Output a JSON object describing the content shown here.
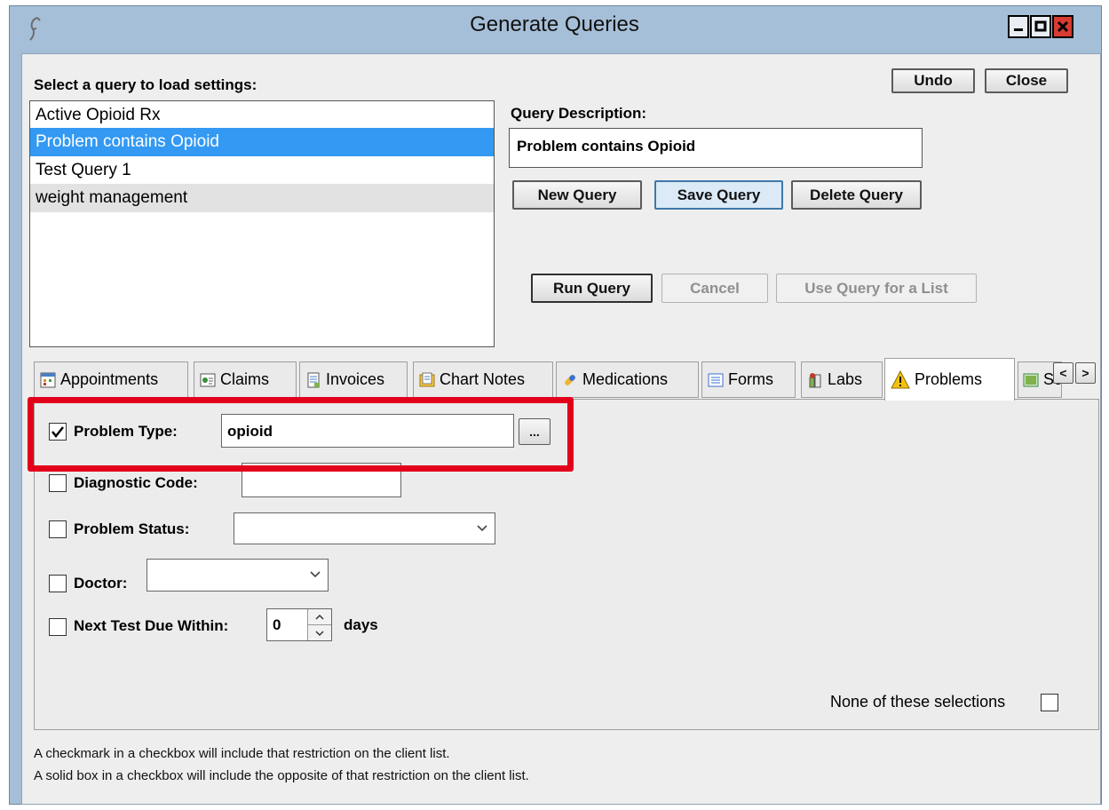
{
  "window": {
    "title": "Generate Queries",
    "controls": {
      "minimize": "–",
      "maximize": "□",
      "close": "✕"
    }
  },
  "toolbar": {
    "undo_label": "Undo",
    "close_label": "Close"
  },
  "query_list": {
    "heading": "Select a query to load settings:",
    "items": [
      {
        "label": "Active Opioid Rx",
        "state": "normal"
      },
      {
        "label": "Problem contains Opioid",
        "state": "selected"
      },
      {
        "label": "Test Query 1",
        "state": "normal"
      },
      {
        "label": "weight management",
        "state": "hover"
      }
    ]
  },
  "query_description": {
    "label": "Query Description:",
    "value": "Problem contains Opioid"
  },
  "query_buttons": {
    "new": "New Query",
    "save": "Save Query",
    "delete": "Delete Query",
    "run": "Run Query",
    "cancel": "Cancel",
    "use_for_list": "Use Query for a List"
  },
  "tabs": [
    {
      "label": "Appointments",
      "icon": "appointments-icon"
    },
    {
      "label": "Claims",
      "icon": "claims-icon"
    },
    {
      "label": "Invoices",
      "icon": "invoices-icon"
    },
    {
      "label": "Chart Notes",
      "icon": "chart-notes-icon"
    },
    {
      "label": "Medications",
      "icon": "medications-icon"
    },
    {
      "label": "Forms",
      "icon": "forms-icon"
    },
    {
      "label": "Labs",
      "icon": "labs-icon"
    },
    {
      "label": "Problems",
      "icon": "warning-icon",
      "active": true
    },
    {
      "label": "Scans",
      "icon": "scans-icon"
    }
  ],
  "tab_scroll": {
    "left": "<",
    "right": ">"
  },
  "problems": {
    "problem_type": {
      "label": "Problem Type:",
      "checked": true,
      "value": "opioid",
      "browse": "..."
    },
    "diagnostic_code": {
      "label": "Diagnostic Code:",
      "checked": false,
      "value": ""
    },
    "problem_status": {
      "label": "Problem Status:",
      "checked": false,
      "value": ""
    },
    "doctor": {
      "label": "Doctor:",
      "checked": false,
      "value": ""
    },
    "next_test_due": {
      "label": "Next Test Due Within:",
      "checked": false,
      "value": "0",
      "unit": "days"
    },
    "none_of_these": {
      "label": "None of these selections",
      "checked": false
    }
  },
  "footnotes": [
    "A checkmark in a checkbox will include that restriction on the client list.",
    "A solid box in a checkbox will include the opposite of that restriction on the client list."
  ],
  "colors": {
    "accent": "#3399f3",
    "highlight": "#e3001b",
    "frame": "#a6bfd8"
  }
}
